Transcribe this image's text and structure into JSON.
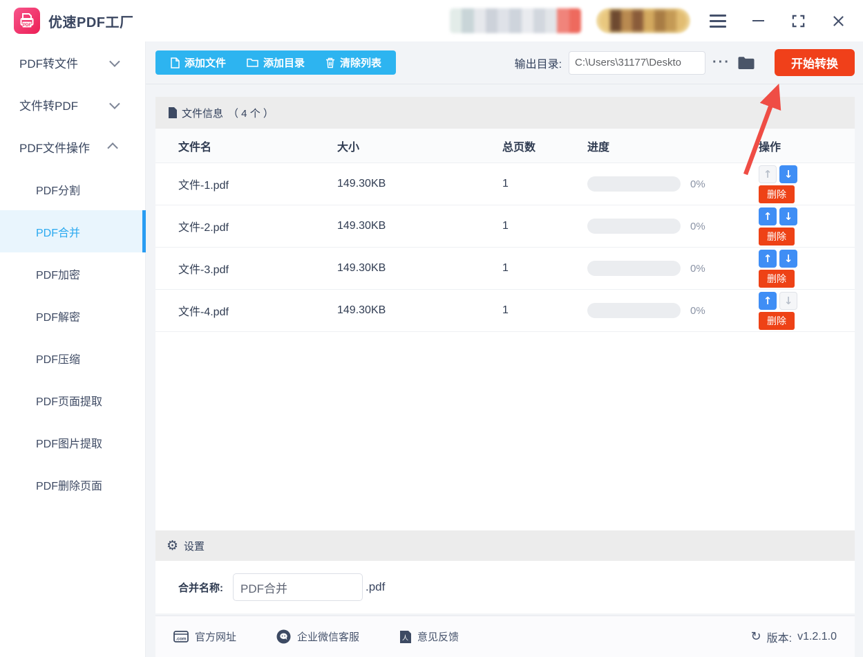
{
  "app": {
    "title": "优速PDF工厂"
  },
  "sidebar": {
    "groups": [
      {
        "label": "PDF转文件",
        "expanded": false
      },
      {
        "label": "文件转PDF",
        "expanded": false
      },
      {
        "label": "PDF文件操作",
        "expanded": true
      }
    ],
    "items": [
      {
        "label": "PDF分割",
        "active": false
      },
      {
        "label": "PDF合并",
        "active": true
      },
      {
        "label": "PDF加密",
        "active": false
      },
      {
        "label": "PDF解密",
        "active": false
      },
      {
        "label": "PDF压缩",
        "active": false
      },
      {
        "label": "PDF页面提取",
        "active": false
      },
      {
        "label": "PDF图片提取",
        "active": false
      },
      {
        "label": "PDF删除页面",
        "active": false
      }
    ]
  },
  "toolbar": {
    "add_file_label": "添加文件",
    "add_folder_label": "添加目录",
    "clear_list_label": "清除列表",
    "output_dir_label": "输出目录:",
    "output_dir_value": "C:\\Users\\31177\\Deskto",
    "browse_more_label": "···",
    "start_button_label": "开始转换"
  },
  "file_panel": {
    "info_title": "文件信息",
    "info_count": "（ 4 个 ）",
    "columns": [
      "文件名",
      "大小",
      "总页数",
      "进度",
      "操作"
    ],
    "rows": [
      {
        "name": "文件-1.pdf",
        "size": "149.30KB",
        "pages": "1",
        "progress": "0%"
      },
      {
        "name": "文件-2.pdf",
        "size": "149.30KB",
        "pages": "1",
        "progress": "0%"
      },
      {
        "name": "文件-3.pdf",
        "size": "149.30KB",
        "pages": "1",
        "progress": "0%"
      },
      {
        "name": "文件-4.pdf",
        "size": "149.30KB",
        "pages": "1",
        "progress": "0%"
      }
    ],
    "delete_label": "删除"
  },
  "settings": {
    "title": "设置",
    "merge_name_label": "合并名称:",
    "merge_name_value": "PDF合并",
    "file_extension": ".pdf"
  },
  "footer": {
    "website_label": "官方网址",
    "wechat_label": "企业微信客服",
    "feedback_label": "意见反馈",
    "version_label": "版本:",
    "version_value": "v1.2.1.0"
  },
  "colors": {
    "toolbar_blue": "#2db4f0",
    "primary_blue": "#3f8ef5",
    "danger_red": "#ee4216",
    "start_button_red": "#f0401a",
    "brand_pink": "#ee2e60",
    "sidebar_active_bg": "#e9f5fd",
    "sidebar_active_text": "#2aa9f0",
    "annotation_red": "#ef4d45"
  }
}
